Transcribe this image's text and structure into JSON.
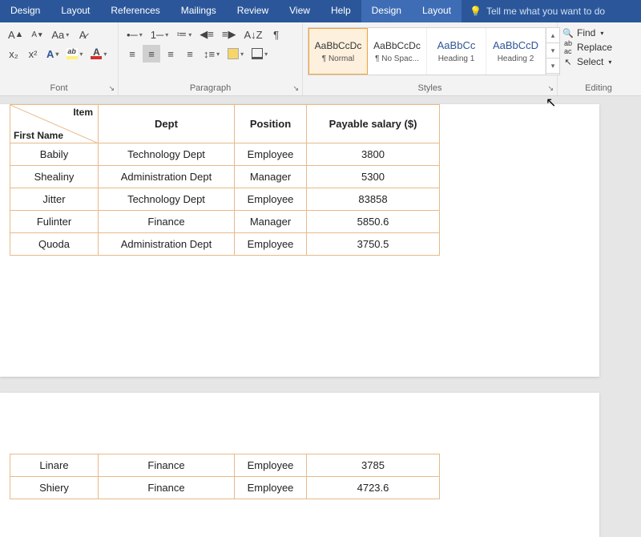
{
  "tabs": {
    "design1": "Design",
    "layout1": "Layout",
    "references": "References",
    "mailings": "Mailings",
    "review": "Review",
    "view": "View",
    "help": "Help",
    "design2": "Design",
    "layout2": "Layout",
    "tell_me_placeholder": "Tell me what you want to do"
  },
  "groups": {
    "font": "Font",
    "paragraph": "Paragraph",
    "styles": "Styles",
    "editing": "Editing"
  },
  "styles": {
    "items": [
      {
        "preview": "AaBbCcDc",
        "name": "¶ Normal",
        "blue": false
      },
      {
        "preview": "AaBbCcDc",
        "name": "¶ No Spac...",
        "blue": false
      },
      {
        "preview": "AaBbCc",
        "name": "Heading 1",
        "blue": true
      },
      {
        "preview": "AaBbCcD",
        "name": "Heading 2",
        "blue": true
      }
    ]
  },
  "editing": {
    "find": "Find",
    "replace": "Replace",
    "select": "Select"
  },
  "table1": {
    "diag_top": "Item",
    "diag_bottom": "First Name",
    "headers": [
      "Dept",
      "Position",
      "Payable salary ($)"
    ],
    "rows": [
      {
        "name": "Babily",
        "dept": "Technology Dept",
        "pos": "Employee",
        "sal": "3800"
      },
      {
        "name": "Shealiny",
        "dept": "Administration Dept",
        "pos": "Manager",
        "sal": "5300"
      },
      {
        "name": "Jitter",
        "dept": "Technology Dept",
        "pos": "Employee",
        "sal": "83858"
      },
      {
        "name": "Fulinter",
        "dept": "Finance",
        "pos": "Manager",
        "sal": "5850.6"
      },
      {
        "name": "Quoda",
        "dept": "Administration Dept",
        "pos": "Employee",
        "sal": "3750.5"
      }
    ]
  },
  "table2": {
    "rows": [
      {
        "name": "Linare",
        "dept": "Finance",
        "pos": "Employee",
        "sal": "3785"
      },
      {
        "name": "Shiery",
        "dept": "Finance",
        "pos": "Employee",
        "sal": "4723.6"
      }
    ]
  }
}
